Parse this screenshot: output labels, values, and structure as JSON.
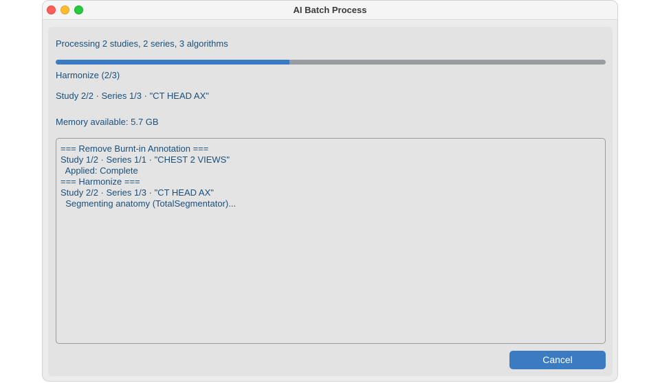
{
  "window": {
    "title": "AI Batch Process"
  },
  "status": {
    "summary": "Processing 2 studies, 2 series, 3 algorithms",
    "progress": 0.425,
    "step": "Harmonize (2/3)",
    "current": "Study 2/2 · Series 1/3 · \"CT HEAD AX\"",
    "memory": "Memory available: 5.7 GB"
  },
  "log": {
    "lines": [
      "=== Remove Burnt-in Annotation ===",
      "Study 1/2 · Series 1/1 · \"CHEST 2 VIEWS\"",
      "  Applied: Complete",
      "=== Harmonize ===",
      "Study 2/2 · Series 1/3 · \"CT HEAD AX\"",
      "  Segmenting anatomy (TotalSegmentator)..."
    ]
  },
  "buttons": {
    "cancel": "Cancel"
  },
  "colors": {
    "accent": "#3a7bc2",
    "text": "#1b4f7a",
    "track": "#969ca1"
  }
}
